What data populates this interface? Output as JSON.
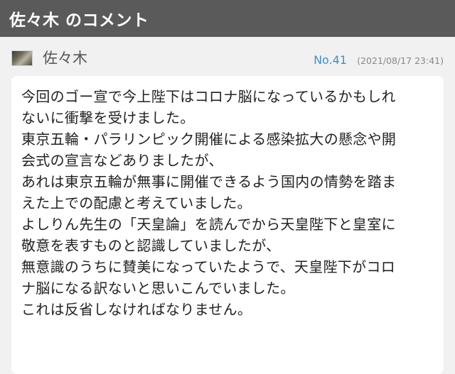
{
  "header": {
    "title": "佐々木 のコメント"
  },
  "comment": {
    "author": "佐々木",
    "number": "No.41",
    "date": "(2021/08/17 23:41)",
    "lines": [
      "今回のゴー宣で今上陛下はコロナ脳になっているかもしれ",
      "ないに衝撃を受けました。",
      "東京五輪・パラリンピック開催による感染拡大の懸念や開",
      "会式の宣言などありましたが、",
      "あれは東京五輪が無事に開催できるよう国内の情勢を踏ま",
      "えた上での配慮と考えていました。",
      "よしりん先生の「天皇論」を読んでから天皇陛下と皇室に",
      "敬意を表すものと認識していましたが、",
      "無意識のうちに賛美になっていたようで、天皇陛下がコロ",
      "ナ脳になる訳ないと思いこんでいました。",
      "これは反省しなければなりません。"
    ]
  },
  "colors": {
    "header_bg": "#5a5a5a",
    "page_bg": "#f1f1f1",
    "link": "#3b8fd0"
  }
}
